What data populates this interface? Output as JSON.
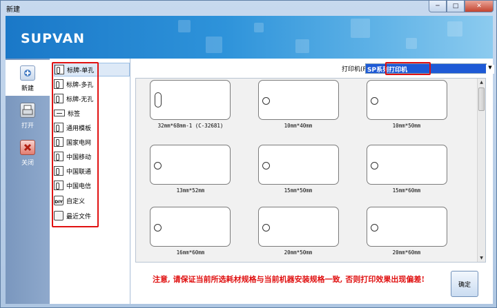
{
  "window": {
    "title": "新建"
  },
  "banner": {
    "brand": "SUPVAN"
  },
  "tools": [
    {
      "label": "新建",
      "icon": "new-doc-icon"
    },
    {
      "label": "打开",
      "icon": "open-printer-icon"
    },
    {
      "label": "关闭",
      "icon": "close-x-icon"
    }
  ],
  "categories": [
    {
      "label": "标牌-单孔"
    },
    {
      "label": "标牌-多孔"
    },
    {
      "label": "标牌-无孔"
    },
    {
      "label": "标签"
    },
    {
      "label": "通用模板"
    },
    {
      "label": "国家电网"
    },
    {
      "label": "中国移动"
    },
    {
      "label": "中国联通"
    },
    {
      "label": "中国电信"
    },
    {
      "label": "自定义"
    },
    {
      "label": "最近文件"
    }
  ],
  "printer": {
    "label": "打印机(P):",
    "value": "SP系列打印机"
  },
  "templates": [
    {
      "label": "32mm*68mm-1 (C-32681)"
    },
    {
      "label": "10mm*40mm"
    },
    {
      "label": "10mm*50mm"
    },
    {
      "label": "13mm*52mm"
    },
    {
      "label": "15mm*50mm"
    },
    {
      "label": "15mm*60mm"
    },
    {
      "label": "16mm*60mm"
    },
    {
      "label": "20mm*50mm"
    },
    {
      "label": "20mm*60mm"
    }
  ],
  "warning": "注意, 请保证当前所选耗材规格与当前机器安装规格一致, 否则打印效果出现偏差!",
  "ok_label": "确定",
  "colors": {
    "accent": "#1e5ad6",
    "alert": "#e01010",
    "banner": "#2e93da"
  }
}
